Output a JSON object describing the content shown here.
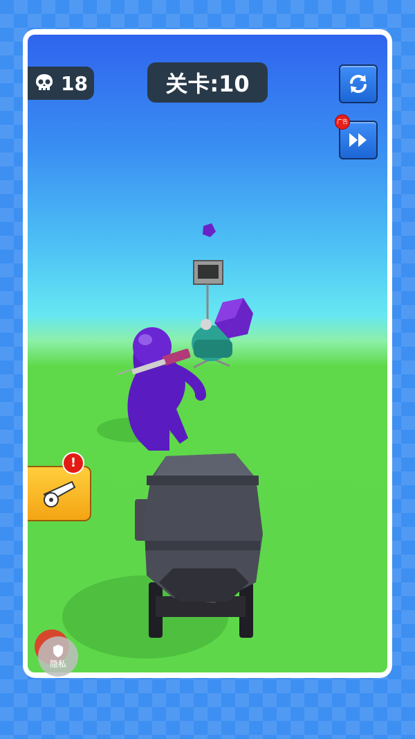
{
  "hud": {
    "kill_count": "18",
    "level_label": "关卡:10",
    "ad_badge": "广告",
    "privacy_label": "隐私",
    "alert_mark": "!"
  },
  "icons": {
    "kills": "skull-icon",
    "restart": "refresh-icon",
    "skip": "fast-forward-icon",
    "cannon_upgrade": "cannon-icon",
    "privacy": "shield-icon"
  },
  "colors": {
    "hud_dark": "#283a4a",
    "button_blue": "#2a78e8",
    "card_orange": "#f8b21f",
    "alert_red": "#e31b14",
    "enemy_purple": "#5a1cc0",
    "ground_green": "#5ed84a"
  }
}
